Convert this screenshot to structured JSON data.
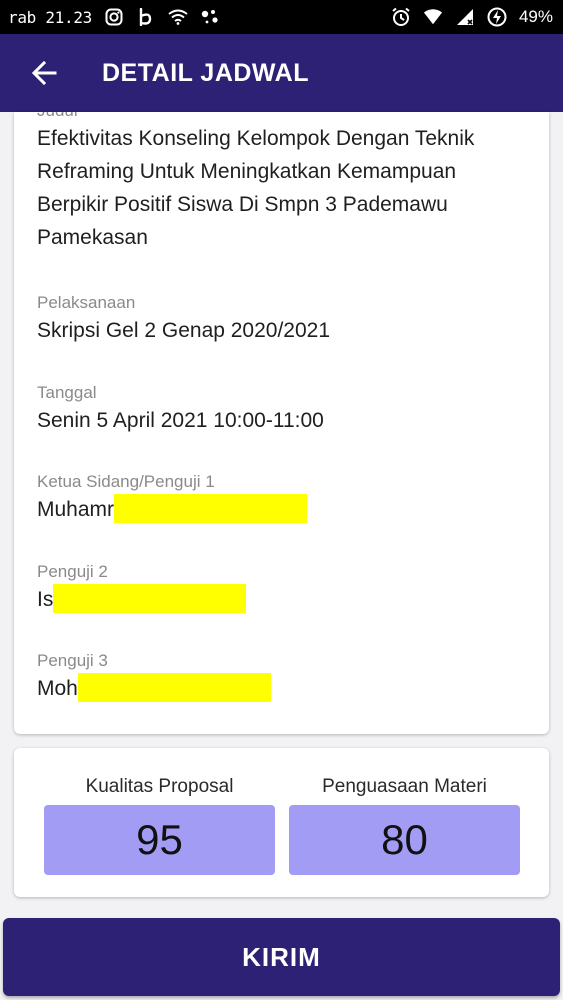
{
  "status_bar": {
    "time": "rab 21.23",
    "battery": "49%",
    "icons": [
      "instagram-icon",
      "beats-icon",
      "wifi-icon",
      "assistant-icon",
      "alarm-icon",
      "wifi-icon",
      "signal-icon",
      "battery-charging-icon"
    ]
  },
  "app_bar": {
    "back_icon": "arrow-back-icon",
    "title": "DETAIL JADWAL",
    "background": "#2c2174"
  },
  "detail": {
    "judul_label": "Judul",
    "judul_value": "Efektivitas Konseling Kelompok Dengan Teknik Reframing Untuk Meningkatkan Kemampuan Berpikir Positif Siswa Di Smpn 3 Pademawu Pamekasan",
    "pelaksanaan_label": "Pelaksanaan",
    "pelaksanaan_value": "Skripsi Gel 2 Genap 2020/2021",
    "tanggal_label": "Tanggal",
    "tanggal_value": "Senin 5 April 2021 10:00-11:00",
    "ketua_label": "Ketua Sidang/Penguji 1",
    "ketua_value": "Muhamr",
    "penguji2_label": "Penguji 2",
    "penguji2_value": "Is",
    "penguji3_label": "Penguji 3",
    "penguji3_value": "Moh",
    "redaction_color": "#ffff00"
  },
  "scores": {
    "kualitas_label": "Kualitas Proposal",
    "kualitas_value": "95",
    "penguasaan_label": "Penguasaan Materi",
    "penguasaan_value": "80",
    "box_color": "#a39cf5"
  },
  "submit": {
    "label": "KIRIM"
  }
}
